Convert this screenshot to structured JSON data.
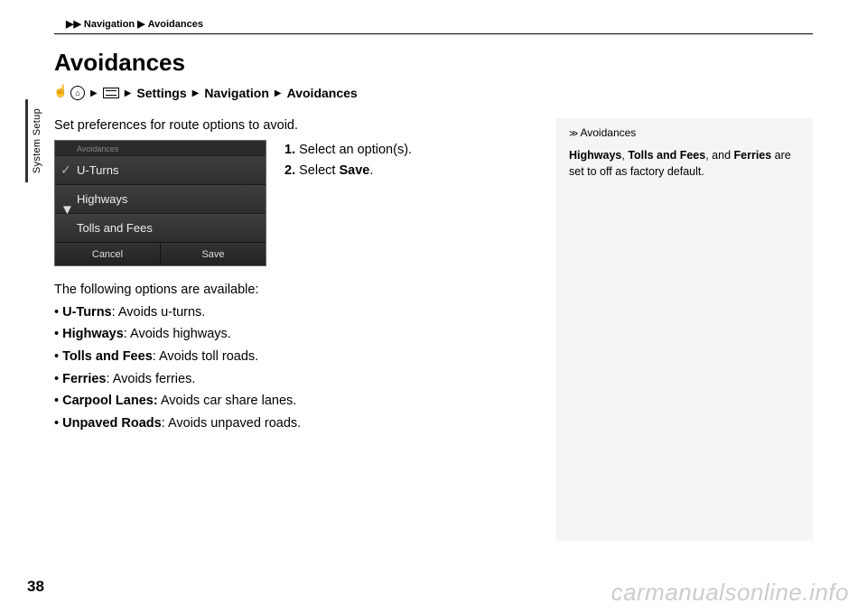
{
  "breadcrumb": {
    "a": "Navigation",
    "b": "Avoidances"
  },
  "sideTab": "System Setup",
  "title": "Avoidances",
  "navPath": {
    "settings": "Settings",
    "navigation": "Navigation",
    "avoidances": "Avoidances"
  },
  "intro": "Set preferences for route options to avoid.",
  "screenshot": {
    "header": "Avoidances",
    "row1": "U-Turns",
    "row2": "Highways",
    "row3": "Tolls and Fees",
    "cancel": "Cancel",
    "save": "Save"
  },
  "steps": {
    "s1n": "1.",
    "s1": " Select an option(s).",
    "s2n": "2.",
    "s2a": " Select ",
    "s2b": "Save",
    "s2c": "."
  },
  "followHead": "The following options are available:",
  "opts": {
    "o1a": "U-Turns",
    "o1b": ": Avoids u-turns.",
    "o2a": "Highways",
    "o2b": ": Avoids highways.",
    "o3a": "Tolls and Fees",
    "o3b": ": Avoids toll roads.",
    "o4a": "Ferries",
    "o4b": ": Avoids ferries.",
    "o5a": "Carpool Lanes:",
    "o5b": " Avoids car share lanes.",
    "o6a": "Unpaved Roads",
    "o6b": ": Avoids unpaved roads."
  },
  "sidebox": {
    "head": "Avoidances",
    "t1": "Highways",
    "t2": ", ",
    "t3": "Tolls and Fees",
    "t4": ", and ",
    "t5": "Ferries",
    "t6": " are set to off as factory default."
  },
  "pagenum": "38",
  "watermark": "carmanualsonline.info"
}
